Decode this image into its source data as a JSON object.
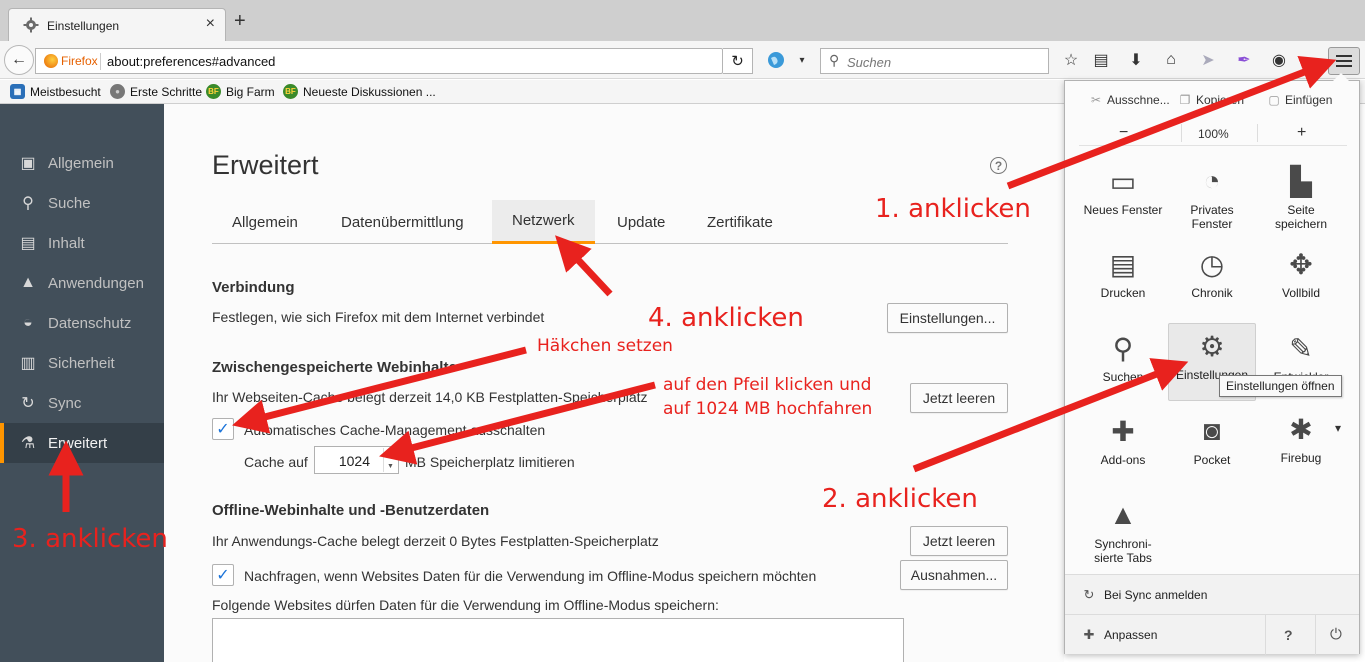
{
  "tab": {
    "title": "Einstellungen",
    "close": "×",
    "new_tab": "+"
  },
  "navbar": {
    "back": "←",
    "identity_label": "Firefox",
    "url": "about:preferences#advanced",
    "reload": "↻",
    "search_placeholder": "Suchen",
    "search_icon": "⚲",
    "dropdown": "▾",
    "icons": {
      "star": "☆",
      "clipboard": "▤",
      "download": "⬇",
      "home": "⌂",
      "send": "➤",
      "feather": "✒",
      "extension": "◉"
    }
  },
  "bookmarks": [
    {
      "label": "Meistbesucht",
      "icon": "▦",
      "color": "#2a6fb8"
    },
    {
      "label": "Erste Schritte",
      "icon": "●",
      "color": "#777777"
    },
    {
      "label": "Big Farm",
      "icon": "BF",
      "color": "#3a8a2a"
    },
    {
      "label": "Neueste Diskussionen ...",
      "icon": "BF",
      "color": "#3a8a2a"
    }
  ],
  "sidebar": {
    "active_color": "#ff9500",
    "items": [
      {
        "label": "Allgemein",
        "icon": "▣"
      },
      {
        "label": "Suche",
        "icon": "⚲"
      },
      {
        "label": "Inhalt",
        "icon": "▤"
      },
      {
        "label": "Anwendungen",
        "icon": "▲"
      },
      {
        "label": "Datenschutz",
        "icon": "◒"
      },
      {
        "label": "Sicherheit",
        "icon": "▥"
      },
      {
        "label": "Sync",
        "icon": "↻"
      },
      {
        "label": "Erweitert",
        "icon": "⚗"
      }
    ]
  },
  "main": {
    "title": "Erweitert",
    "help": "?",
    "tabs": [
      {
        "label": "Allgemein"
      },
      {
        "label": "Datenübermittlung"
      },
      {
        "label": "Netzwerk"
      },
      {
        "label": "Update"
      },
      {
        "label": "Zertifikate"
      }
    ],
    "connection": {
      "heading": "Verbindung",
      "desc": "Festlegen, wie sich Firefox mit dem Internet verbindet",
      "button": "Einstellungen..."
    },
    "cache": {
      "heading": "Zwischengespeicherte Webinhalte",
      "desc": "Ihr Webseiten-Cache belegt derzeit 14,0 KB Festplatten-Speicherplatz",
      "clear_button": "Jetzt leeren",
      "auto_checked": "✓",
      "auto_label": "Automatisches Cache-Management ausschalten",
      "limit_prefix": "Cache auf",
      "limit_value": "1024",
      "limit_suffix": "MB Speicherplatz limitieren",
      "spin_up": "▲",
      "spin_down": "▼"
    },
    "offline": {
      "heading": "Offline-Webinhalte und -Benutzerdaten",
      "desc": "Ihr Anwendungs-Cache belegt derzeit 0 Bytes Festplatten-Speicherplatz",
      "clear_button": "Jetzt leeren",
      "ask_checked": "✓",
      "ask_label": "Nachfragen, wenn Websites Daten für die Verwendung im Offline-Modus speichern möchten",
      "exceptions_button": "Ausnahmen...",
      "list_label": "Folgende Websites dürfen Daten für die Verwendung im Offline-Modus speichern:"
    }
  },
  "menu_panel": {
    "edit": [
      {
        "label": "Ausschne...",
        "icon": "✂"
      },
      {
        "label": "Kopieren",
        "icon": "❐"
      },
      {
        "label": "Einfügen",
        "icon": "▢"
      }
    ],
    "zoom": {
      "minus": "−",
      "value": "100%",
      "plus": "+"
    },
    "items": [
      {
        "label": "Neues Fenster",
        "icon": "▭"
      },
      {
        "label": "Privates Fenster",
        "icon": "◔"
      },
      {
        "label": "Seite speichern",
        "icon": "▙"
      },
      {
        "label": "Drucken",
        "icon": "▤"
      },
      {
        "label": "Chronik",
        "icon": "◷"
      },
      {
        "label": "Vollbild",
        "icon": "✥"
      },
      {
        "label": "Suchen",
        "icon": "⚲"
      },
      {
        "label": "Einstellungen",
        "icon": "⚙"
      },
      {
        "label": "Entwickler",
        "icon": "✎"
      },
      {
        "label": "Add-ons",
        "icon": "✚"
      },
      {
        "label": "Pocket",
        "icon": "◙"
      },
      {
        "label": "Firebug",
        "icon": "✱"
      },
      {
        "label": "Synchroni-sierte Tabs",
        "icon": "▲"
      }
    ],
    "firebug_dropdown": "▾",
    "tooltip": "Einstellungen öffnen",
    "sync": {
      "label": "Bei Sync anmelden",
      "icon": "↻"
    },
    "customize": {
      "label": "Anpassen",
      "icon": "✚"
    },
    "help_icon": "?",
    "quit_icon": "⏻"
  },
  "annotations": {
    "color": "#e8221e",
    "step1": "1. anklicken",
    "step2": "2. anklicken",
    "step3": "3. anklicken",
    "step4": "4. anklicken",
    "check": "Häkchen setzen",
    "arrow_line1": "auf den Pfeil klicken und",
    "arrow_line2": "auf 1024 MB hochfahren"
  }
}
